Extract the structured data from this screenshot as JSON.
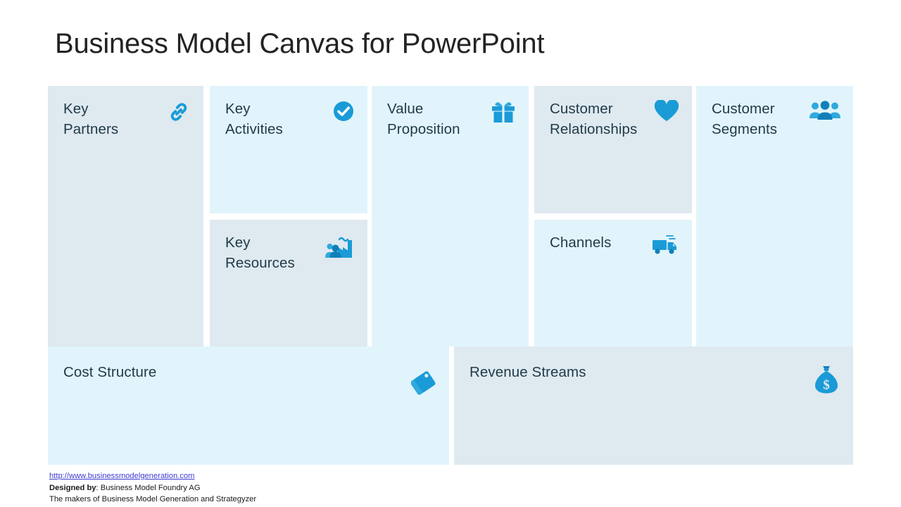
{
  "page_title": "Business Model Canvas for PowerPoint",
  "colors": {
    "tone_light": "#e1f4fb",
    "tone_grey": "#dfe9f0",
    "icon_blue": "#1a9bd7",
    "title_text": "#232323",
    "panel_text": "#1f3a47",
    "link": "#3b3bd1"
  },
  "panels": {
    "key_partners": {
      "title": "Key\nPartners",
      "icon": "chain-link-icon",
      "tone": "grey"
    },
    "key_activities": {
      "title": "Key\nActivities",
      "icon": "check-circle-icon",
      "tone": "light"
    },
    "key_resources": {
      "title": "Key\nResources",
      "icon": "factory-people-icon",
      "tone": "grey"
    },
    "value_proposition": {
      "title": "Value\nProposition",
      "icon": "gift-box-icon",
      "tone": "light"
    },
    "customer_relationships": {
      "title": "Customer\nRelationships",
      "icon": "heart-icon",
      "tone": "grey"
    },
    "channels": {
      "title": "Channels",
      "icon": "delivery-truck-icon",
      "tone": "light"
    },
    "customer_segments": {
      "title": "Customer\nSegments",
      "icon": "people-group-icon",
      "tone": "light"
    },
    "cost_structure": {
      "title": "Cost Structure",
      "icon": "price-tags-icon",
      "tone": "light"
    },
    "revenue_streams": {
      "title": "Revenue Streams",
      "icon": "money-bag-icon",
      "tone": "grey"
    }
  },
  "footer": {
    "url": "http://www.businessmodelgeneration.com",
    "designed_by_label": "Designed by",
    "designed_by_value": ": Business Model Foundry AG",
    "makers_line": "The makers of Business Model Generation and Strategyzer"
  }
}
